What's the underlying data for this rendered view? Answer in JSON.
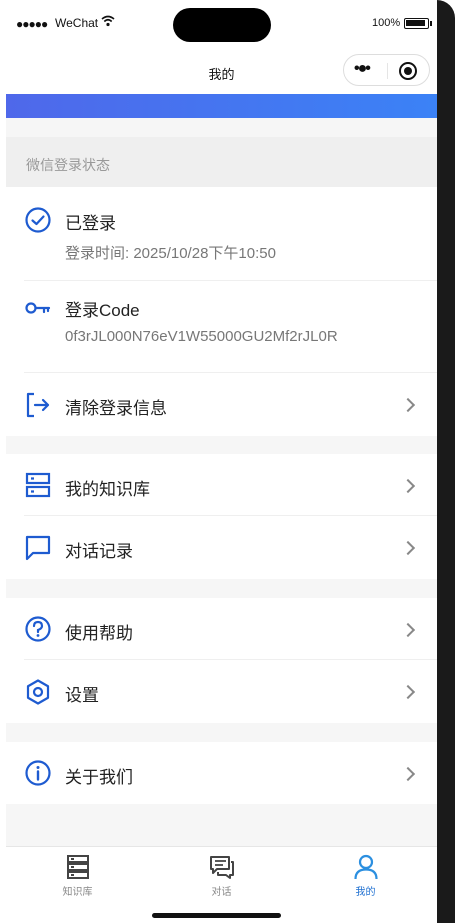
{
  "status_bar": {
    "signal": "●●●●●",
    "carrier": "WeChat",
    "battery": "100%"
  },
  "nav": {
    "title": "我的"
  },
  "section_label": "微信登录状态",
  "login": {
    "status_title": "已登录",
    "login_time": "登录时间: 2025/10/28下午10:50",
    "code_title": "登录Code",
    "code_value": "0f3rJL000N76eV1W55000GU2Mf2rJL0R",
    "clear_label": "清除登录信息"
  },
  "menu_groups": [
    {
      "items": [
        "我的知识库",
        "对话记录"
      ]
    },
    {
      "items": [
        "使用帮助",
        "设置"
      ]
    },
    {
      "items": [
        "关于我们"
      ]
    }
  ],
  "tabs": [
    {
      "label": "知识库",
      "icon": "database-icon",
      "active": false
    },
    {
      "label": "对话",
      "icon": "chat-icon",
      "active": false
    },
    {
      "label": "我的",
      "icon": "user-icon",
      "active": true
    }
  ],
  "colors": {
    "accent": "#1e5bd0",
    "active_tab": "#1e6fd0",
    "banner_start": "#4f68ea",
    "banner_end": "#3b82f6"
  }
}
